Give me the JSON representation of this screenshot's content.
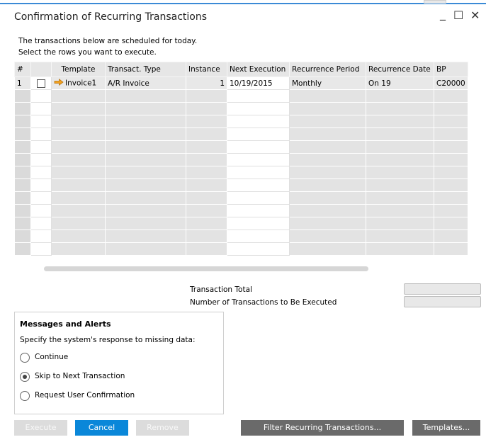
{
  "window": {
    "title": "Confirmation of Recurring Transactions",
    "minimize": "_",
    "maximize": "☐",
    "close": "✕"
  },
  "intro": {
    "line1": "The transactions below are scheduled for today.",
    "line2": "Select the rows you want to execute."
  },
  "grid": {
    "headers": [
      "#",
      "",
      "Template",
      "Transact. Type",
      "Instance",
      "Next Execution",
      "Recurrence Period",
      "Recurrence Date",
      "BP"
    ],
    "rows": [
      {
        "num": "1",
        "checked": false,
        "template": "Invoice1",
        "type": "A/R Invoice",
        "instance": "1",
        "next": "10/19/2015",
        "period": "Monthly",
        "rdate": "On 19",
        "bp": "C20000"
      }
    ],
    "empty_rows": 13,
    "link_arrow_icon": "orange-arrow-icon"
  },
  "totals": {
    "total_label": "Transaction Total",
    "count_label": "Number of Transactions to Be Executed",
    "total_value": "",
    "count_value": ""
  },
  "messages": {
    "title": "Messages and Alerts",
    "subtitle": "Specify the system's response to missing data:",
    "options": [
      {
        "label": "Continue",
        "selected": false
      },
      {
        "label": "Skip to Next Transaction",
        "selected": true
      },
      {
        "label": "Request User Confirmation",
        "selected": false
      }
    ]
  },
  "buttons": {
    "execute": "Execute",
    "cancel": "Cancel",
    "remove": "Remove",
    "filter": "Filter Recurring Transactions...",
    "templates": "Templates..."
  },
  "colors": {
    "accent": "#0a87d9",
    "arrow": "#f0a020",
    "title_strip": "#3b8ad6"
  }
}
